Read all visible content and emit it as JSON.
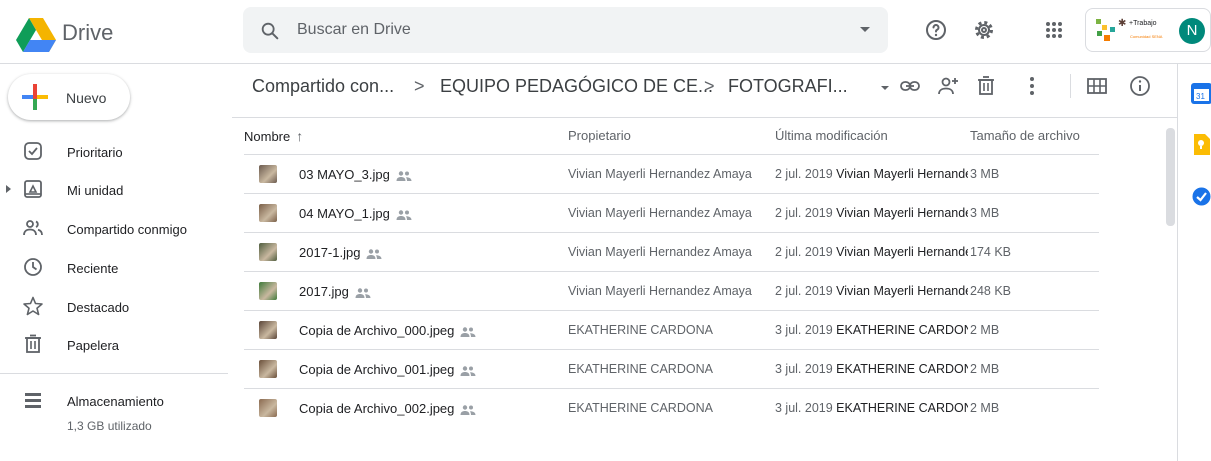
{
  "app": {
    "name": "Drive"
  },
  "search": {
    "placeholder": "Buscar en Drive"
  },
  "header_icons": [
    "help-icon",
    "settings-icon",
    "apps-icon"
  ],
  "account": {
    "avatar_letter": "N",
    "org_logo_text": "+Trabajo",
    "org_logo_subtext": "Comunidad SENA",
    "avatar_color": "#00897b"
  },
  "sidebar": {
    "new_label": "Nuevo",
    "items": [
      {
        "label": "Prioritario",
        "icon": "priority-icon"
      },
      {
        "label": "Mi unidad",
        "icon": "my-drive-icon"
      },
      {
        "label": "Compartido conmigo",
        "icon": "shared-with-me-icon"
      },
      {
        "label": "Reciente",
        "icon": "recent-icon"
      },
      {
        "label": "Destacado",
        "icon": "star-icon"
      },
      {
        "label": "Papelera",
        "icon": "trash-icon"
      }
    ],
    "storage": {
      "label": "Almacenamiento",
      "used": "1,3 GB utilizado"
    }
  },
  "breadcrumb": {
    "items": [
      "Compartido con...",
      "EQUIPO PEDAGÓGICO DE CE...",
      "FOTOGRAFI..."
    ],
    "separator": ">"
  },
  "toolbar_icons": [
    "link-icon",
    "add-person-icon",
    "trash-icon",
    "more-vert-icon",
    "grid-view-icon",
    "info-icon"
  ],
  "table": {
    "columns": {
      "name": "Nombre",
      "name_sort": "↑",
      "owner": "Propietario",
      "modified": "Última modificación",
      "size": "Tamaño de archivo"
    },
    "rows": [
      {
        "name": "03 MAYO_3.jpg",
        "owner": "Vivian Mayerli Hernandez Amaya",
        "mod_date": "2 jul. 2019",
        "mod_by": "Vivian Mayerli Hernandez Amaya",
        "size": "3 MB",
        "thumb_color": "#6b5a4e"
      },
      {
        "name": "04 MAYO_1.jpg",
        "owner": "Vivian Mayerli Hernandez Amaya",
        "mod_date": "2 jul. 2019",
        "mod_by": "Vivian Mayerli Hernandez Amaya",
        "size": "3 MB",
        "thumb_color": "#7a5f48"
      },
      {
        "name": "2017-1.jpg",
        "owner": "Vivian Mayerli Hernandez Amaya",
        "mod_date": "2 jul. 2019",
        "mod_by": "Vivian Mayerli Hernandez Amaya",
        "size": "174 KB",
        "thumb_color": "#4f5d3e"
      },
      {
        "name": "2017.jpg",
        "owner": "Vivian Mayerli Hernandez Amaya",
        "mod_date": "2 jul. 2019",
        "mod_by": "Vivian Mayerli Hernandez Amaya",
        "size": "248 KB",
        "thumb_color": "#3f7a3a"
      },
      {
        "name": "Copia de Archivo_000.jpeg",
        "owner": "EKATHERINE CARDONA",
        "mod_date": "3 jul. 2019",
        "mod_by": "EKATHERINE CARDONA",
        "size": "2 MB",
        "thumb_color": "#5a4538"
      },
      {
        "name": "Copia de Archivo_001.jpeg",
        "owner": "EKATHERINE CARDONA",
        "mod_date": "3 jul. 2019",
        "mod_by": "EKATHERINE CARDONA",
        "size": "2 MB",
        "thumb_color": "#6a4f3a"
      },
      {
        "name": "Copia de Archivo_002.jpeg",
        "owner": "EKATHERINE CARDONA",
        "mod_date": "3 jul. 2019",
        "mod_by": "EKATHERINE CARDONA",
        "size": "2 MB",
        "thumb_color": "#8a6a50"
      }
    ]
  },
  "right_panel_icons": [
    "calendar-icon",
    "keep-icon",
    "tasks-icon"
  ],
  "colors": {
    "drive_green": "#0f9d58",
    "drive_yellow": "#f4b400",
    "drive_blue": "#4285f4",
    "drive_red": "#db4437",
    "calendar_blue": "#1a73e8",
    "keep_yellow": "#fbbc04",
    "tasks_blue": "#1a73e8"
  }
}
